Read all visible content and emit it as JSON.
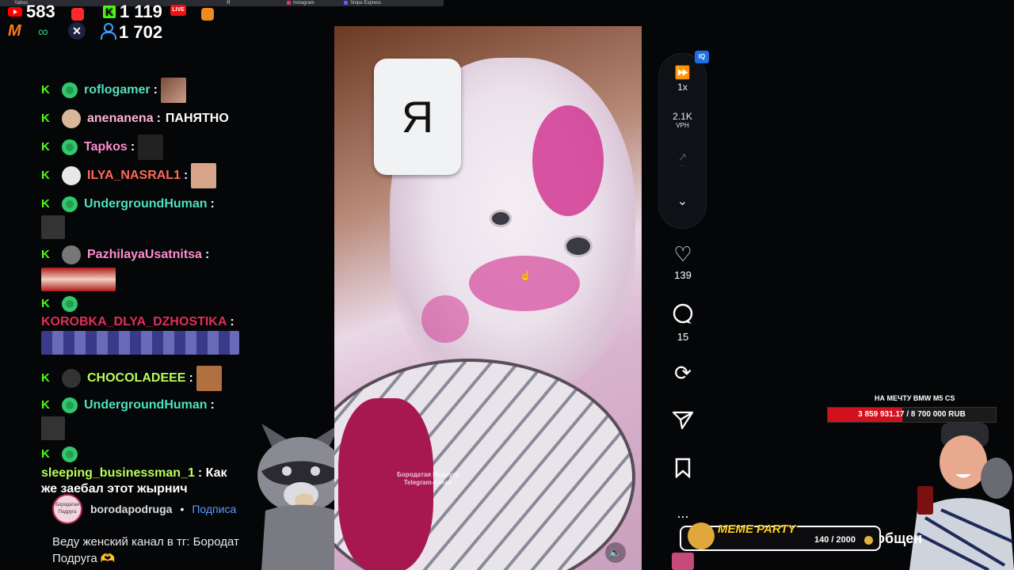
{
  "bookmarks": [
    "Yahoo",
    "Я",
    "Instagram",
    "Stripe Express"
  ],
  "stats": {
    "youtube_viewers": "583",
    "kick_viewers": "1 119",
    "live_badge": "LIVE",
    "viewers_total": "1 702"
  },
  "chat": [
    {
      "user": "roflogamer",
      "color": "#4fe3c1",
      "text": ""
    },
    {
      "user": "anenanena",
      "color": "#ffb3d1",
      "text": "ПАНЯТНО"
    },
    {
      "user": "Tapkos",
      "color": "#ff8fd0",
      "text": ""
    },
    {
      "user": "ILYA_NASRAL1",
      "color": "#ff6a5a",
      "text": ""
    },
    {
      "user": "UndergroundHuman",
      "color": "#4fe3c1",
      "text": ""
    },
    {
      "user": "PazhilayaUsatnitsa",
      "color": "#ff8fd0",
      "text": ""
    },
    {
      "user": "KOROBKA_DLYA_DZHOSTIKA",
      "color": "#e0305a",
      "text": ""
    },
    {
      "user": "CHOCOLADEEE",
      "color": "#b8ff5a",
      "text": ""
    },
    {
      "user": "UndergroundHuman",
      "color": "#4fe3c1",
      "text": ""
    },
    {
      "user": "sleeping_businessman_1",
      "color": "#b8ff5a",
      "text": "Как же заебал этот жырнич"
    }
  ],
  "video": {
    "letter": "Я",
    "watermark": "Бородатая Подруга Telegram-канал",
    "channel": "borodapodruga",
    "subscribe": "Подписа",
    "caption": "Веду женский канал в тг: Бородат Подруга 🫶",
    "avatar_text": "Бородатая Подруга"
  },
  "rail": {
    "iq": "IQ",
    "speed": "1x",
    "vph_value": "2.1K",
    "vph_label": "VPH",
    "trend": "..."
  },
  "actions": {
    "likes": "139",
    "comments": "15",
    "more": "..."
  },
  "goal": {
    "title": "НА МЕЧТУ BMW M5 CS",
    "progress_text": "3 859 931.17 / 8 700 000 RUB",
    "current": 3859931.17,
    "target": 8700000
  },
  "meme": {
    "title": "MEME PARTY",
    "count": "140 / 2000"
  },
  "overlay": {
    "message_fragment": "общен"
  }
}
